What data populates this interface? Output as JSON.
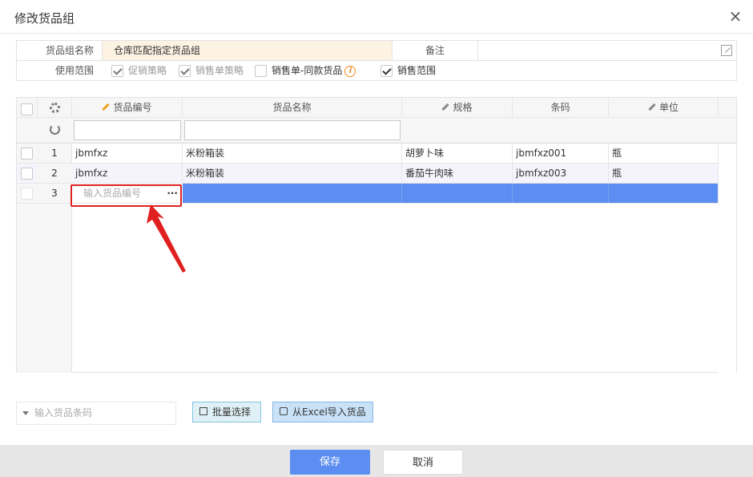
{
  "dialog": {
    "title": "修改货品组",
    "close": "×"
  },
  "form": {
    "name_label": "货品组名称",
    "name_value": "仓库匹配指定货品组",
    "remark_label": "备注",
    "remark_value": "",
    "scope_label": "使用范围",
    "scope_options": [
      {
        "label": "促销策略",
        "checked": true,
        "disabled": true
      },
      {
        "label": "销售单策略",
        "checked": true,
        "disabled": true
      },
      {
        "label": "销售单-同款货品",
        "checked": false,
        "disabled": false
      },
      {
        "label": "销售范围",
        "checked": true,
        "disabled": false
      }
    ]
  },
  "grid": {
    "columns": [
      "货品编号",
      "货品名称",
      "规格",
      "条码",
      "单位"
    ],
    "rows": [
      {
        "num": "1",
        "code": "jbmfxz",
        "name": "米粉箱装",
        "spec": "胡萝卜味",
        "barcode": "jbmfxz001",
        "unit": "瓶"
      },
      {
        "num": "2",
        "code": "jbmfxz",
        "name": "米粉箱装",
        "spec": "番茄牛肉味",
        "barcode": "jbmfxz003",
        "unit": "瓶"
      },
      {
        "num": "3",
        "code": "",
        "name": "",
        "spec": "",
        "barcode": "",
        "unit": ""
      }
    ],
    "new_row_placeholder": "输入货品编号",
    "more": "···"
  },
  "tools": {
    "barcode_placeholder": "输入货品条码",
    "batch_select": "批量选择",
    "excel_import": "从Excel导入货品"
  },
  "footer": {
    "save": "保存",
    "cancel": "取消"
  },
  "colors": {
    "accent": "#5b8ef0",
    "selected_row": "#5b8ef0",
    "annotation": "#e02020"
  }
}
